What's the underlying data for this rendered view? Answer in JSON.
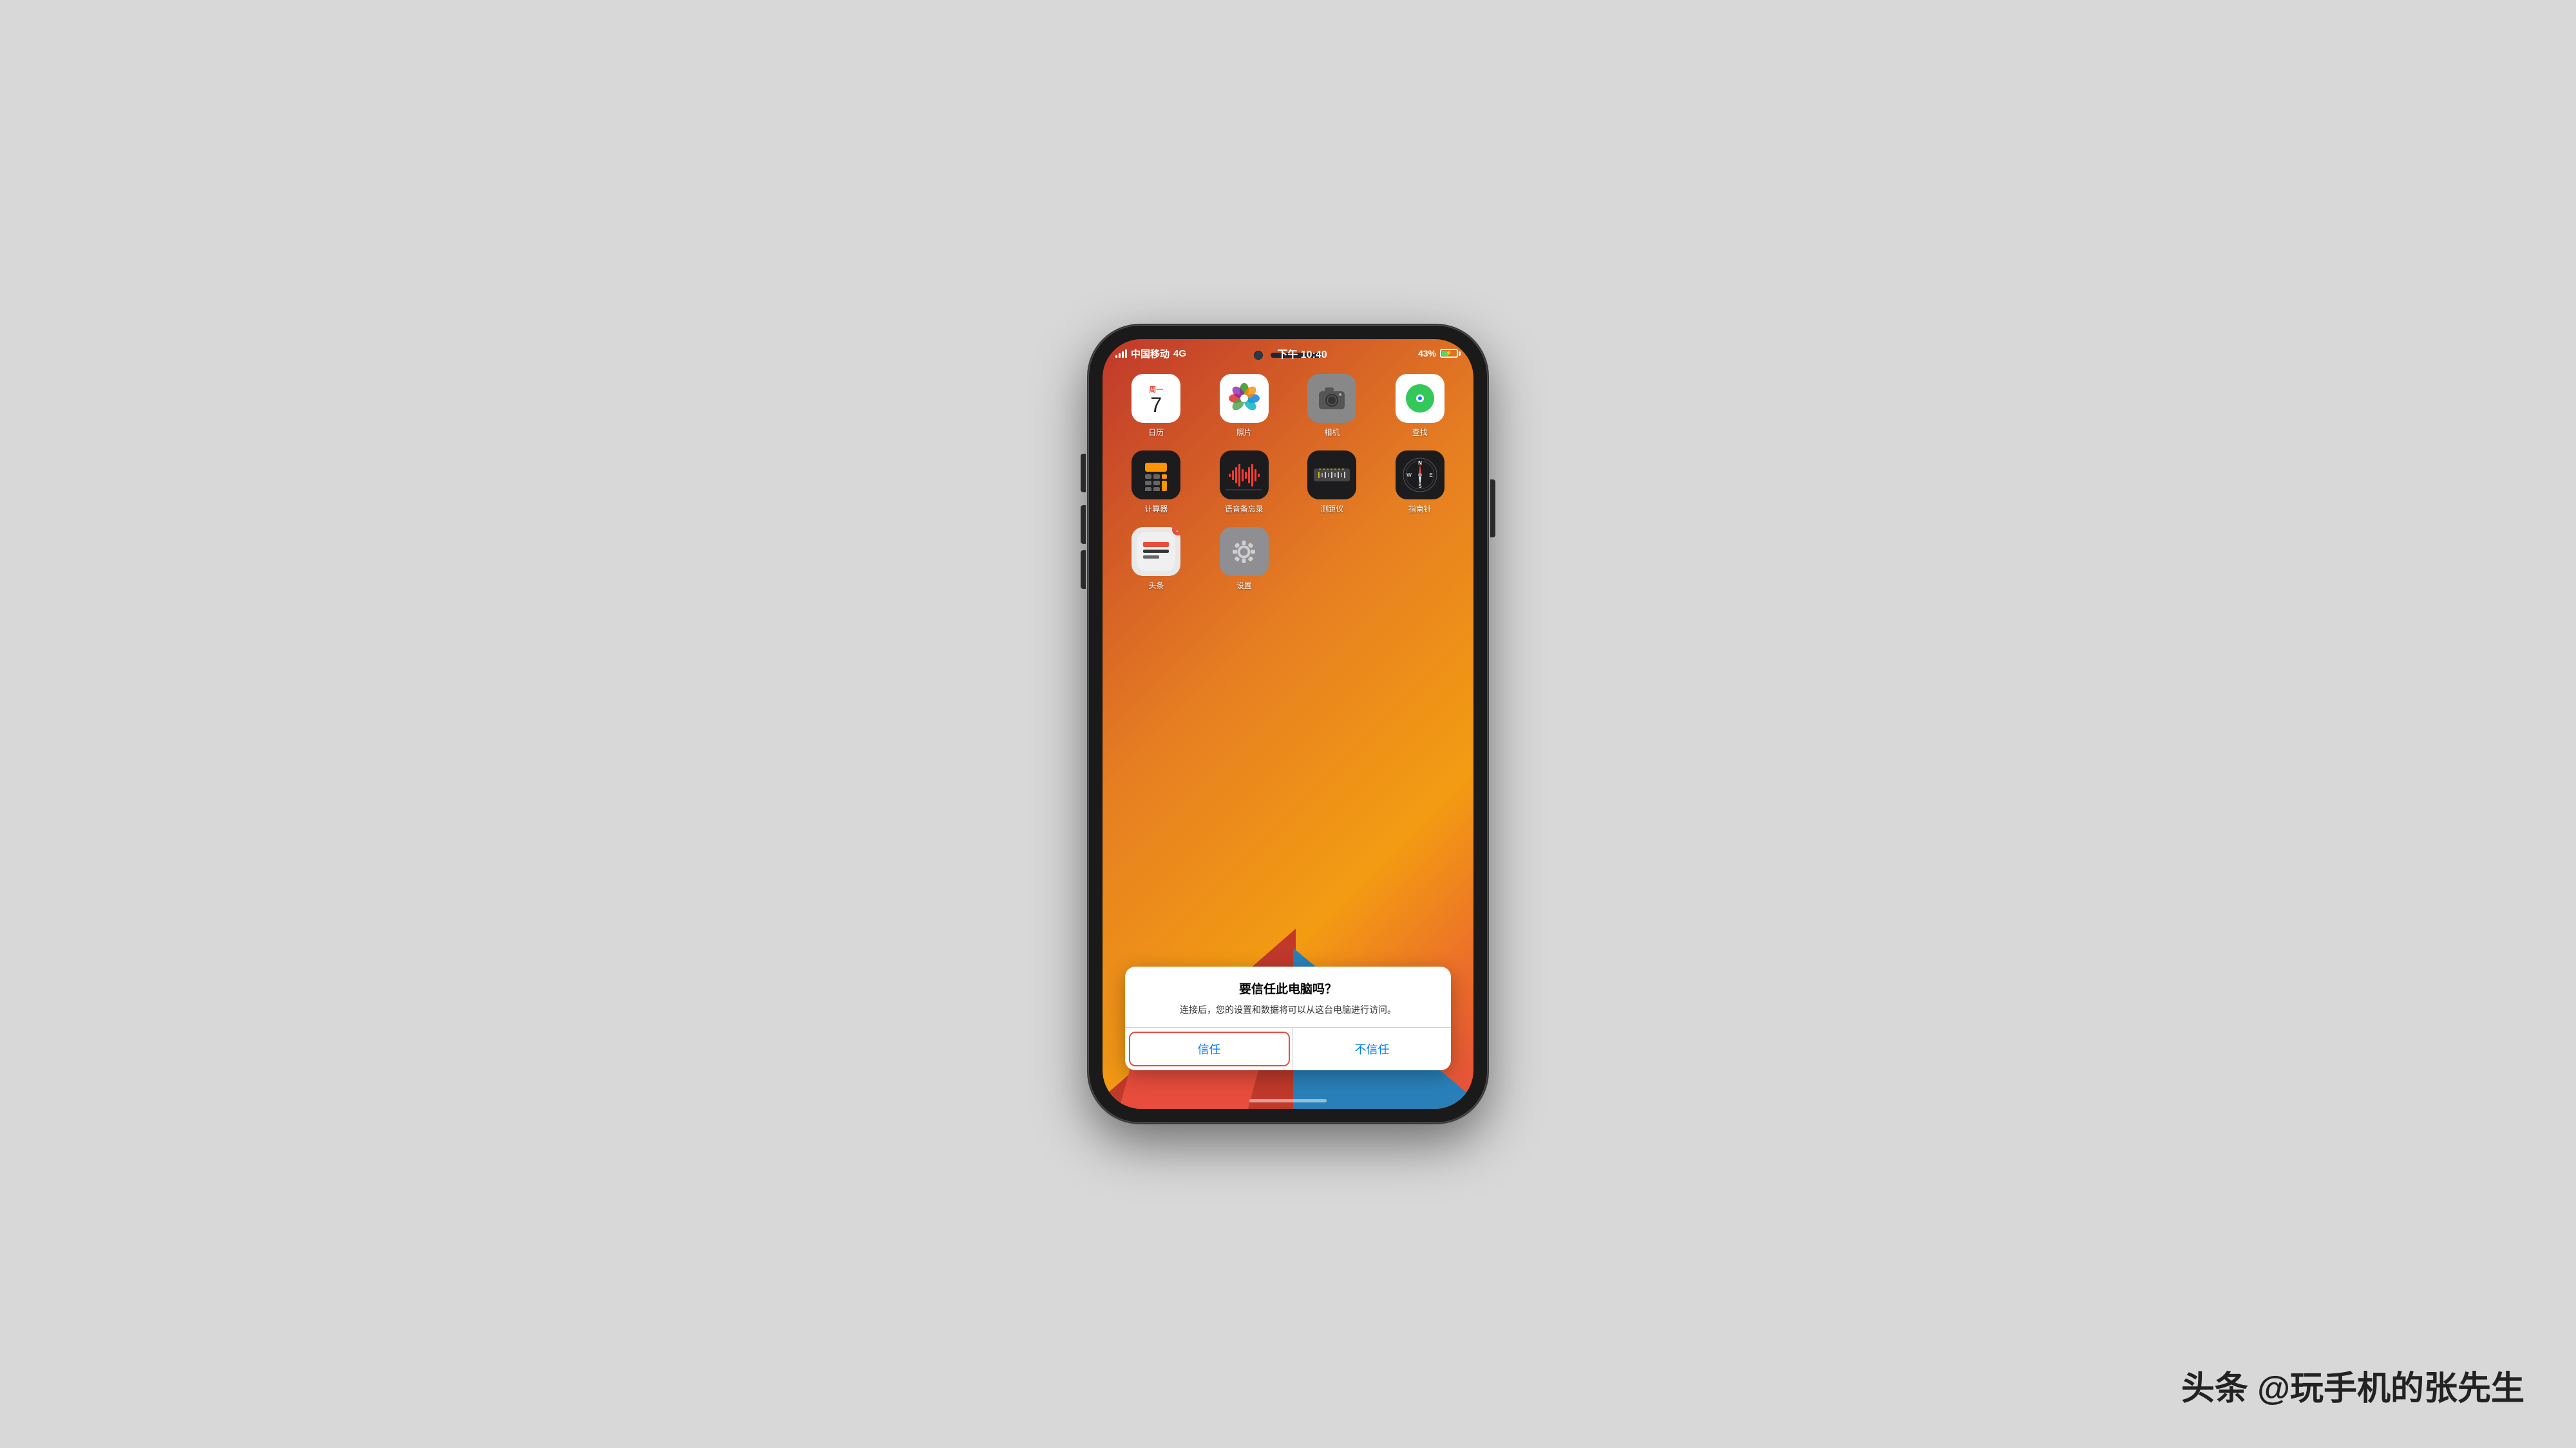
{
  "watermark": {
    "text": "头条 @玩手机的张先生"
  },
  "status_bar": {
    "carrier": "中国移动",
    "network": "4G",
    "time": "下午 10:40",
    "battery_percent": "43%"
  },
  "apps": [
    {
      "id": "calendar",
      "label": "日历",
      "day_name": "周一",
      "day": "7"
    },
    {
      "id": "photos",
      "label": "照片"
    },
    {
      "id": "camera",
      "label": "相机"
    },
    {
      "id": "findmy",
      "label": "查找"
    },
    {
      "id": "calculator",
      "label": "计算器"
    },
    {
      "id": "voice_memo",
      "label": "语音备忘录"
    },
    {
      "id": "measure",
      "label": "测距仪"
    },
    {
      "id": "compass",
      "label": "指南针"
    },
    {
      "id": "toutiao",
      "label": "头条",
      "badge": "2"
    },
    {
      "id": "settings",
      "label": "设置"
    }
  ],
  "dialog": {
    "title": "要信任此电脑吗？",
    "message": "连接后，您的设置和数据将可以从这台电脑进行访问。",
    "btn_trust": "信任",
    "btn_dont_trust": "不信任"
  }
}
